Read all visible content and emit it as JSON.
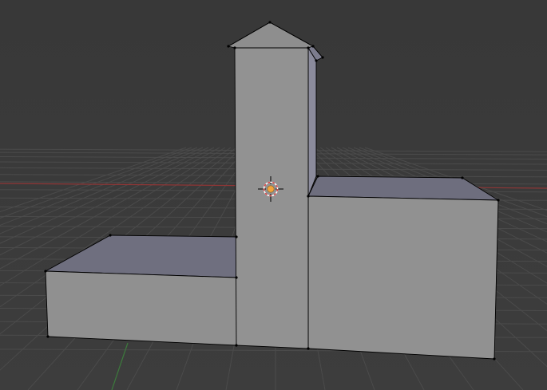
{
  "app": {
    "view": "3d-viewport",
    "mode": "edit"
  },
  "scene": {
    "object": "building-mesh",
    "axes": {
      "x_axis_color": "#9a3a3a",
      "y_axis_color": "#3f7a3f"
    },
    "colors": {
      "background_top": "#393939",
      "background_bottom": "#3b3b3b",
      "grid_line": "#4a4a4a",
      "face_front": "#8f8f8f",
      "face_top": "#6e6e7e",
      "face_side": "#8a8a9a",
      "edge": "#000000",
      "vertex": "#000000",
      "cursor_ring_outer": "#e05050",
      "cursor_ring_inner": "#ffffff",
      "cursor_center": "#f2a640"
    }
  },
  "cursor": {
    "icon": "3d-cursor-icon"
  }
}
